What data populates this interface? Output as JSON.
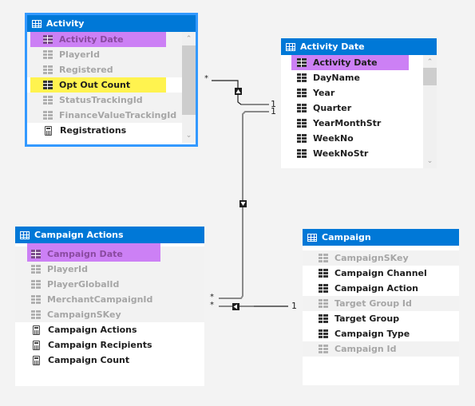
{
  "tables": {
    "activity": {
      "title": "Activity",
      "icon": "table-icon",
      "fields": [
        {
          "name": "Activity Date",
          "kind": "column",
          "hidden": true,
          "highlight": "purple"
        },
        {
          "name": "PlayerId",
          "kind": "column",
          "hidden": true
        },
        {
          "name": "Registered",
          "kind": "column",
          "hidden": true
        },
        {
          "name": "Opt Out Count",
          "kind": "column",
          "hidden": false,
          "highlight": "yellow"
        },
        {
          "name": "StatusTrackingId",
          "kind": "column",
          "hidden": true
        },
        {
          "name": "FinanceValueTrackingId",
          "kind": "column",
          "hidden": true
        },
        {
          "name": "Registrations",
          "kind": "measure",
          "hidden": false
        }
      ]
    },
    "activity_date": {
      "title": "Activity Date",
      "icon": "table-icon",
      "fields": [
        {
          "name": "Activity Date",
          "kind": "column",
          "hidden": false,
          "highlight": "purple"
        },
        {
          "name": "DayName",
          "kind": "column",
          "hidden": false
        },
        {
          "name": "Year",
          "kind": "column",
          "hidden": false
        },
        {
          "name": "Quarter",
          "kind": "column",
          "hidden": false
        },
        {
          "name": "YearMonthStr",
          "kind": "column",
          "hidden": false
        },
        {
          "name": "WeekNo",
          "kind": "column",
          "hidden": false
        },
        {
          "name": "WeekNoStr",
          "kind": "column",
          "hidden": false
        }
      ]
    },
    "campaign_actions": {
      "title": "Campaign Actions",
      "icon": "table-icon",
      "fields": [
        {
          "name": "Campaign Date",
          "kind": "column",
          "hidden": true,
          "highlight": "purple"
        },
        {
          "name": "PlayerId",
          "kind": "column",
          "hidden": true
        },
        {
          "name": "PlayerGlobalId",
          "kind": "column",
          "hidden": true
        },
        {
          "name": "MerchantCampaignId",
          "kind": "column",
          "hidden": true
        },
        {
          "name": "CampaignSKey",
          "kind": "column",
          "hidden": true
        },
        {
          "name": "Campaign Actions",
          "kind": "measure",
          "hidden": false
        },
        {
          "name": "Campaign Recipients",
          "kind": "measure",
          "hidden": false
        },
        {
          "name": "Campaign Count",
          "kind": "measure",
          "hidden": false
        }
      ]
    },
    "campaign": {
      "title": "Campaign",
      "icon": "table-icon",
      "fields": [
        {
          "name": "CampaignSKey",
          "kind": "column",
          "hidden": true
        },
        {
          "name": "Campaign Channel",
          "kind": "column",
          "hidden": false
        },
        {
          "name": "Campaign Action",
          "kind": "column",
          "hidden": false
        },
        {
          "name": "Target Group Id",
          "kind": "column",
          "hidden": true
        },
        {
          "name": "Target Group",
          "kind": "column",
          "hidden": false
        },
        {
          "name": "Campaign Type",
          "kind": "column",
          "hidden": false
        },
        {
          "name": "Campaign Id",
          "kind": "column",
          "hidden": true
        }
      ]
    }
  },
  "relationships": [
    {
      "from": "Activity",
      "to": "Activity Date",
      "from_card": "*",
      "to_card": "1",
      "filter_direction": "up"
    },
    {
      "from": "Campaign Actions",
      "to": "Activity Date",
      "from_card": "*",
      "to_card": "1",
      "filter_direction": "down"
    },
    {
      "from": "Campaign Actions",
      "to": "Campaign",
      "from_card": "*",
      "to_card": "1",
      "filter_direction": "left"
    }
  ],
  "labels": {
    "star": "*",
    "one": "1"
  }
}
